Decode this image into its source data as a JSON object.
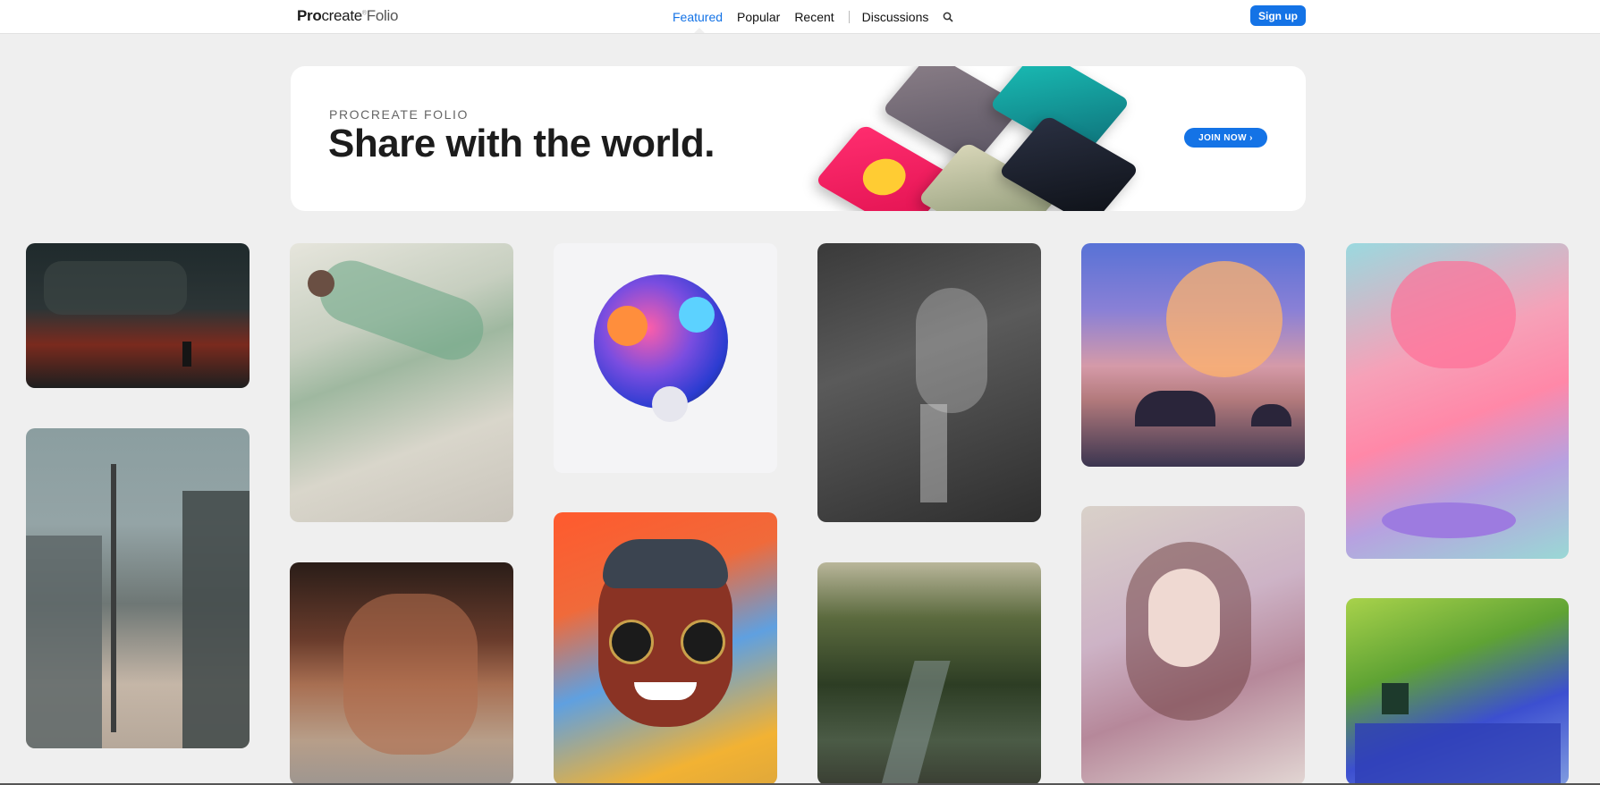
{
  "nav": {
    "logo_bold": "Pro",
    "logo_rest": "create",
    "logo_folio": "Folio",
    "items": [
      "Featured",
      "Popular",
      "Recent"
    ],
    "discussions": "Discussions",
    "signup": "Sign up"
  },
  "banner": {
    "eyebrow": "PROCREATE FOLIO",
    "headline": "Share with the world.",
    "cta": "JOIN NOW ›"
  },
  "colors": {
    "accent": "#1473e6",
    "page_bg": "#efefef"
  },
  "gallery": [
    {
      "name": "artwork-helicopter-scene"
    },
    {
      "name": "artwork-woman-in-green"
    },
    {
      "name": "artwork-abstract-blobs"
    },
    {
      "name": "artwork-profile-portrait"
    },
    {
      "name": "artwork-clouds-sunset"
    },
    {
      "name": "artwork-pink-figure"
    },
    {
      "name": "artwork-alley-street"
    },
    {
      "name": "artwork-old-man-portrait"
    },
    {
      "name": "artwork-man-with-sunglasses"
    },
    {
      "name": "artwork-forest-stream"
    },
    {
      "name": "artwork-woman-portrait"
    },
    {
      "name": "artwork-house-trees"
    }
  ]
}
